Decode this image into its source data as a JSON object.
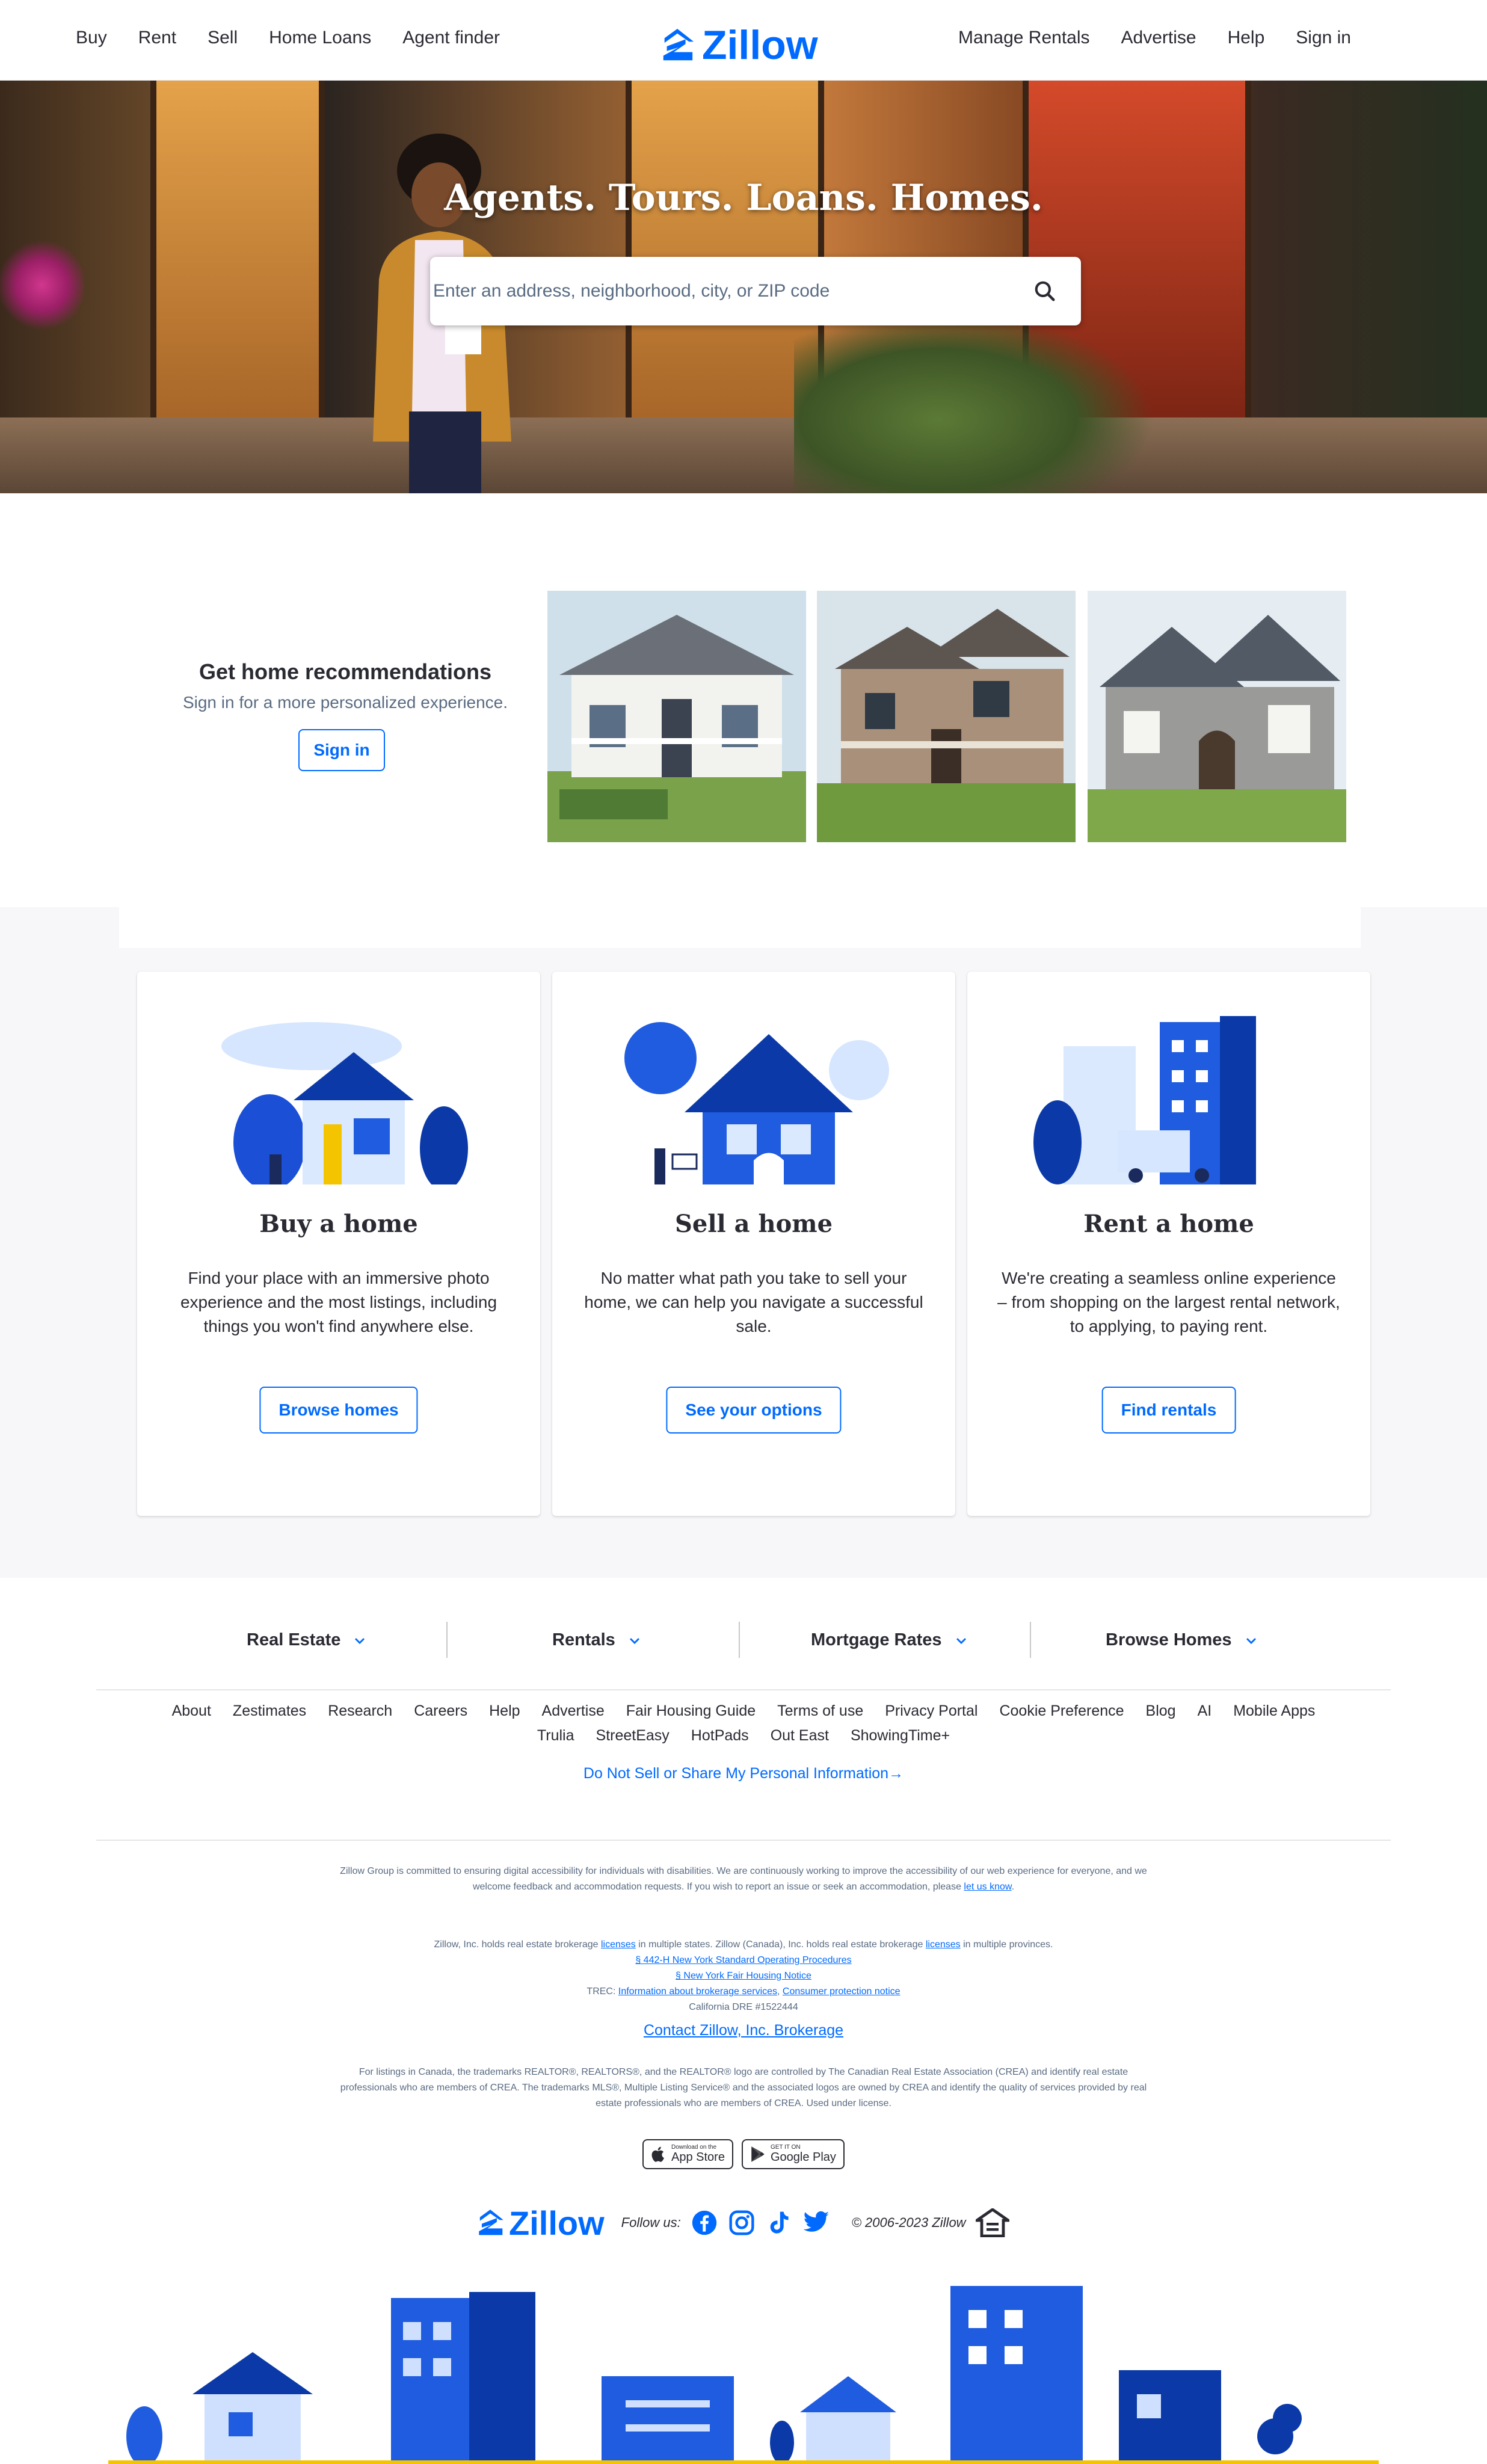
{
  "header": {
    "nav_left": [
      "Buy",
      "Rent",
      "Sell",
      "Home Loans",
      "Agent finder"
    ],
    "brand": "Zillow",
    "nav_right": [
      "Manage Rentals",
      "Advertise",
      "Help",
      "Sign in"
    ]
  },
  "hero": {
    "title": "Agents. Tours. Loans. Homes.",
    "search_placeholder": "Enter an address, neighborhood, city, or ZIP code",
    "search_icon": "search-icon"
  },
  "recommendations": {
    "title": "Get home recommendations",
    "subtitle": "Sign in for a more personalized experience.",
    "button": "Sign in"
  },
  "cards": [
    {
      "title": "Buy a home",
      "description": "Find your place with an immersive photo experience and the most listings, including things you won't find anywhere else.",
      "button": "Browse homes"
    },
    {
      "title": "Sell a home",
      "description": "No matter what path you take to sell your home, we can help you navigate a successful sale.",
      "button": "See your options"
    },
    {
      "title": "Rent a home",
      "description": "We're creating a seamless online experience – from shopping on the largest rental network, to applying, to paying rent.",
      "button": "Find rentals"
    }
  ],
  "footer": {
    "categories": [
      "Real Estate",
      "Rentals",
      "Mortgage Rates",
      "Browse Homes"
    ],
    "links_row1": [
      "About",
      "Zestimates",
      "Research",
      "Careers",
      "Help",
      "Advertise",
      "Fair Housing Guide",
      "Terms of use",
      "Privacy Portal",
      "Cookie Preference",
      "Blog",
      "AI",
      "Mobile Apps"
    ],
    "links_row2": [
      "Trulia",
      "StreetEasy",
      "HotPads",
      "Out East",
      "ShowingTime+"
    ],
    "privacy": "Do Not Sell or Share My Personal Information→",
    "accessibility_text": "Zillow Group is committed to ensuring digital accessibility for individuals with disabilities. We are continuously working to improve the accessibility of our web experience for everyone, and we welcome feedback and accommodation requests. If you wish to report an issue or seek an accommodation, please",
    "accessibility_link": "let us know",
    "license_text_1": "Zillow, Inc. holds real estate brokerage",
    "license_link_1": "licenses",
    "license_text_2": "in multiple states. Zillow (Canada), Inc. holds real estate brokerage",
    "license_link_2": "licenses",
    "license_text_3": "in multiple provinces.",
    "ny_procedures": "§ 442-H New York Standard Operating Procedures",
    "ny_notice": "§ New York Fair Housing Notice",
    "trec_label": "TREC:",
    "trec_link_1": "Information about brokerage services",
    "trec_link_2": "Consumer protection notice",
    "california": "California DRE #1522444",
    "contact": "Contact Zillow, Inc. Brokerage",
    "crea_text": "For listings in Canada, the trademarks REALTOR®, REALTORS®, and the REALTOR® logo are controlled by The Canadian Real Estate Association (CREA) and identify real estate professionals who are members of CREA. The trademarks MLS®, Multiple Listing Service® and the associated logos are owned by CREA and identify the quality of services provided by real estate professionals who are members of CREA. Used under license.",
    "app_store_small": "Download on the",
    "app_store_big": "App Store",
    "google_small": "GET IT ON",
    "google_big": "Google Play",
    "brand": "Zillow",
    "follow": "Follow us:",
    "social": [
      "facebook-icon",
      "instagram-icon",
      "tiktok-icon",
      "twitter-icon"
    ],
    "copyright": "© 2006-2023 Zillow"
  },
  "colors": {
    "brand_blue": "#006aff",
    "text": "#2a2a33",
    "muted": "#596b82",
    "section_gray": "#f7f7f9"
  }
}
